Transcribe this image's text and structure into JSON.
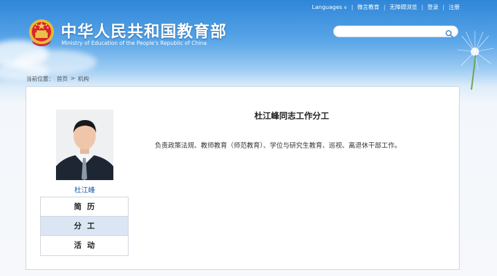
{
  "header": {
    "title_cn": "中华人民共和国教育部",
    "title_en": "Ministry of Education of the People's Republic of China",
    "top_links": {
      "languages": "Languages",
      "weibo": "微言教育",
      "accessibility": "无障碍浏览",
      "login": "登录",
      "register": "注册",
      "separator": "|"
    },
    "search": {
      "placeholder": "",
      "value": ""
    }
  },
  "breadcrumb": {
    "label": "当前位置：",
    "home": "首页",
    "separator": ">",
    "current": "机构"
  },
  "profile": {
    "name": "杜江峰",
    "menu": [
      {
        "label": "简历",
        "active": false
      },
      {
        "label": "分工",
        "active": true
      },
      {
        "label": "活动",
        "active": false
      }
    ]
  },
  "content": {
    "title": "杜江峰同志工作分工",
    "text": "负责政策法规、教师教育（师范教育）、学位与研究生教育、巡视、离退休干部工作。"
  },
  "colors": {
    "header_blue": "#2f86d8",
    "active_menu": "#dbe6f5",
    "name_link": "#1a5aa8"
  }
}
